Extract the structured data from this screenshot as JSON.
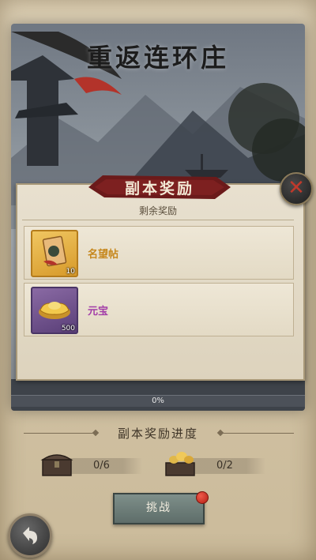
{
  "header": {
    "title": "重返连环庄"
  },
  "panel": {
    "title": "副本奖励",
    "subtitle": "剩余奖励",
    "rewards": [
      {
        "name": "名望帖",
        "quantity": "10",
        "rarity_color": "#c6871c",
        "icon": "invitation-card-icon"
      },
      {
        "name": "元宝",
        "quantity": "500",
        "rarity_color": "#a33ea8",
        "icon": "gold-ingot-icon"
      }
    ]
  },
  "progress": {
    "label": "0%",
    "value": 0
  },
  "reward_progress": {
    "title": "副本奖励进度",
    "milestones": [
      {
        "value": "0/6",
        "icon": "treasure-chest-icon"
      },
      {
        "value": "0/2",
        "icon": "gold-chest-icon"
      }
    ]
  },
  "actions": {
    "challenge_label": "挑战"
  },
  "colors": {
    "accent_red": "#c0392b",
    "banner": "#6b1a1a"
  }
}
